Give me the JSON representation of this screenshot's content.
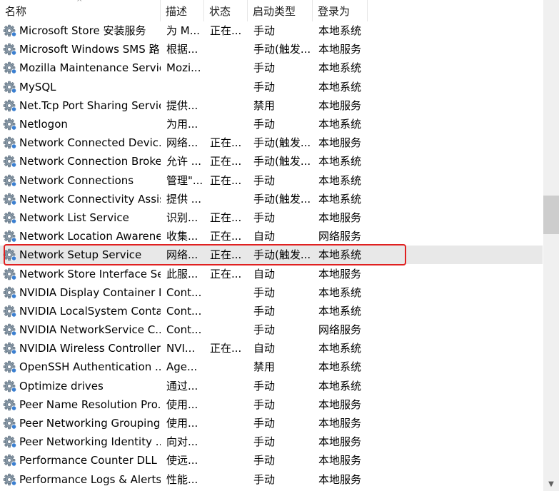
{
  "columns": {
    "name": "名称",
    "desc": "描述",
    "status": "状态",
    "startup": "启动类型",
    "logon": "登录为"
  },
  "selected_index": 12,
  "services": [
    {
      "name": "Microsoft Store 安装服务",
      "desc": "为 M...",
      "status": "正在...",
      "startup": "手动",
      "logon": "本地系统"
    },
    {
      "name": "Microsoft Windows SMS 路...",
      "desc": "根据...",
      "status": "",
      "startup": "手动(触发...",
      "logon": "本地服务"
    },
    {
      "name": "Mozilla Maintenance Service",
      "desc": "Mozi...",
      "status": "",
      "startup": "手动",
      "logon": "本地系统"
    },
    {
      "name": "MySQL",
      "desc": "",
      "status": "",
      "startup": "手动",
      "logon": "本地系统"
    },
    {
      "name": "Net.Tcp Port Sharing Service",
      "desc": "提供...",
      "status": "",
      "startup": "禁用",
      "logon": "本地服务"
    },
    {
      "name": "Netlogon",
      "desc": "为用...",
      "status": "",
      "startup": "手动",
      "logon": "本地系统"
    },
    {
      "name": "Network Connected Devic...",
      "desc": "网络...",
      "status": "正在...",
      "startup": "手动(触发...",
      "logon": "本地服务"
    },
    {
      "name": "Network Connection Broker",
      "desc": "允许 ...",
      "status": "正在...",
      "startup": "手动(触发...",
      "logon": "本地系统"
    },
    {
      "name": "Network Connections",
      "desc": "管理\"...",
      "status": "正在...",
      "startup": "手动",
      "logon": "本地系统"
    },
    {
      "name": "Network Connectivity Assis...",
      "desc": "提供 ...",
      "status": "",
      "startup": "手动(触发...",
      "logon": "本地系统"
    },
    {
      "name": "Network List Service",
      "desc": "识别...",
      "status": "正在...",
      "startup": "手动",
      "logon": "本地服务"
    },
    {
      "name": "Network Location Awarene...",
      "desc": "收集...",
      "status": "正在...",
      "startup": "自动",
      "logon": "网络服务"
    },
    {
      "name": "Network Setup Service",
      "desc": "网络...",
      "status": "正在...",
      "startup": "手动(触发...",
      "logon": "本地系统"
    },
    {
      "name": "Network Store Interface Se...",
      "desc": "此服...",
      "status": "正在...",
      "startup": "自动",
      "logon": "本地服务"
    },
    {
      "name": "NVIDIA Display Container LS",
      "desc": "Cont...",
      "status": "",
      "startup": "手动",
      "logon": "本地系统"
    },
    {
      "name": "NVIDIA LocalSystem Conta...",
      "desc": "Cont...",
      "status": "",
      "startup": "手动",
      "logon": "本地系统"
    },
    {
      "name": "NVIDIA NetworkService C...",
      "desc": "Cont...",
      "status": "",
      "startup": "手动",
      "logon": "网络服务"
    },
    {
      "name": "NVIDIA Wireless Controller...",
      "desc": "NVI...",
      "status": "正在...",
      "startup": "自动",
      "logon": "本地系统"
    },
    {
      "name": "OpenSSH Authentication ...",
      "desc": "Age...",
      "status": "",
      "startup": "禁用",
      "logon": "本地系统"
    },
    {
      "name": "Optimize drives",
      "desc": "通过...",
      "status": "",
      "startup": "手动",
      "logon": "本地系统"
    },
    {
      "name": "Peer Name Resolution Pro...",
      "desc": "使用...",
      "status": "",
      "startup": "手动",
      "logon": "本地服务"
    },
    {
      "name": "Peer Networking Grouping",
      "desc": "使用...",
      "status": "",
      "startup": "手动",
      "logon": "本地服务"
    },
    {
      "name": "Peer Networking Identity ...",
      "desc": "向对...",
      "status": "",
      "startup": "手动",
      "logon": "本地服务"
    },
    {
      "name": "Performance Counter DLL ...",
      "desc": "使远...",
      "status": "",
      "startup": "手动",
      "logon": "本地服务"
    },
    {
      "name": "Performance Logs & Alerts",
      "desc": "性能...",
      "status": "",
      "startup": "手动",
      "logon": "本地服务"
    }
  ],
  "icons": {
    "service": "gear-icon",
    "sort": "sort-indicator-icon"
  },
  "colors": {
    "highlight": "#e02020",
    "selected_row": "#e8e8e8"
  }
}
